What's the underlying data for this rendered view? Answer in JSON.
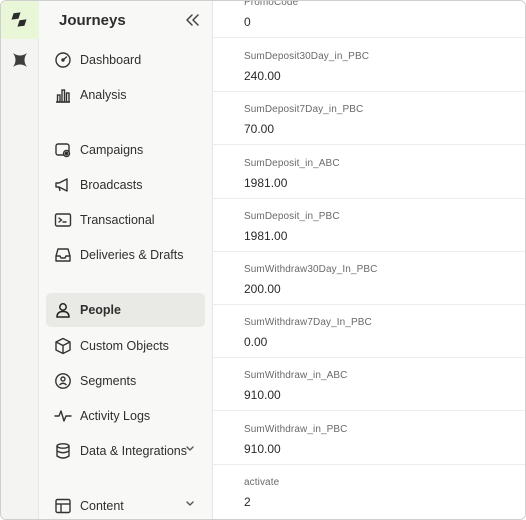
{
  "sidebar": {
    "title": "Journeys",
    "items": [
      {
        "id": "dashboard",
        "label": "Dashboard",
        "icon": "gauge-icon"
      },
      {
        "id": "analysis",
        "label": "Analysis",
        "icon": "bar-chart-icon"
      },
      {
        "id": "campaigns",
        "label": "Campaigns",
        "icon": "campaign-icon"
      },
      {
        "id": "broadcasts",
        "label": "Broadcasts",
        "icon": "megaphone-icon"
      },
      {
        "id": "transactional",
        "label": "Transactional",
        "icon": "terminal-icon"
      },
      {
        "id": "deliveries",
        "label": "Deliveries & Drafts",
        "icon": "inbox-icon"
      },
      {
        "id": "people",
        "label": "People",
        "icon": "person-icon",
        "active": true
      },
      {
        "id": "custom-objects",
        "label": "Custom Objects",
        "icon": "cube-icon"
      },
      {
        "id": "segments",
        "label": "Segments",
        "icon": "segment-icon"
      },
      {
        "id": "activity-logs",
        "label": "Activity Logs",
        "icon": "pulse-icon"
      },
      {
        "id": "data-integrations",
        "label": "Data & Integrations",
        "icon": "database-icon",
        "expandable": true
      },
      {
        "id": "content",
        "label": "Content",
        "icon": "layout-icon",
        "expandable": true
      }
    ]
  },
  "attributes": [
    {
      "key": "PromoCode",
      "value": "0"
    },
    {
      "key": "SumDeposit30Day_in_PBC",
      "value": "240.00"
    },
    {
      "key": "SumDeposit7Day_in_PBC",
      "value": "70.00"
    },
    {
      "key": "SumDeposit_in_ABC",
      "value": "1981.00"
    },
    {
      "key": "SumDeposit_in_PBC",
      "value": "1981.00"
    },
    {
      "key": "SumWithdraw30Day_In_PBC",
      "value": "200.00"
    },
    {
      "key": "SumWithdraw7Day_In_PBC",
      "value": "0.00"
    },
    {
      "key": "SumWithdraw_in_ABC",
      "value": "910.00"
    },
    {
      "key": "SumWithdraw_in_PBC",
      "value": "910.00"
    },
    {
      "key": "activate",
      "value": "2"
    }
  ],
  "colors": {
    "rail_active": "#eaf6d8",
    "brand": "#2d2d2d"
  }
}
